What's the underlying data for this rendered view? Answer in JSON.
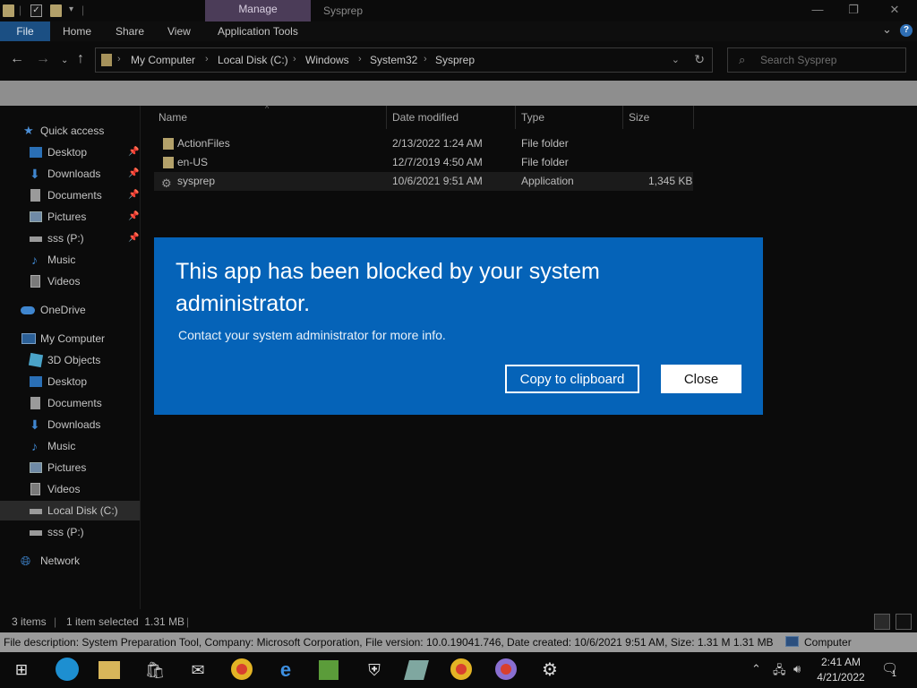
{
  "titlebar": {
    "manage_tab": "Manage",
    "title": "Sysprep",
    "min": "—",
    "restore": "❐",
    "close": "✕"
  },
  "ribbon": {
    "tabs": [
      "File",
      "Home",
      "Share",
      "View",
      "Application Tools"
    ],
    "expand": "⌄",
    "help": "?"
  },
  "address": {
    "crumbs": [
      "My Computer",
      "Local Disk (C:)",
      "Windows",
      "System32",
      "Sysprep"
    ],
    "search_placeholder": "Search Sysprep"
  },
  "sidebar": {
    "quick_access": "Quick access",
    "quick_items": [
      {
        "label": "Desktop",
        "icon": "desktop-icon",
        "pinned": true
      },
      {
        "label": "Downloads",
        "icon": "download-icon",
        "pinned": true
      },
      {
        "label": "Documents",
        "icon": "document-icon",
        "pinned": true
      },
      {
        "label": "Pictures",
        "icon": "pictures-icon",
        "pinned": true
      },
      {
        "label": "sss (P:)",
        "icon": "drive-icon",
        "pinned": true
      },
      {
        "label": "Music",
        "icon": "music-icon",
        "pinned": false
      },
      {
        "label": "Videos",
        "icon": "video-icon",
        "pinned": false
      }
    ],
    "onedrive": "OneDrive",
    "my_computer": "My Computer",
    "computer_items": [
      {
        "label": "3D Objects",
        "icon": "3d-objects-icon"
      },
      {
        "label": "Desktop",
        "icon": "desktop-icon"
      },
      {
        "label": "Documents",
        "icon": "document-icon"
      },
      {
        "label": "Downloads",
        "icon": "download-icon"
      },
      {
        "label": "Music",
        "icon": "music-icon"
      },
      {
        "label": "Pictures",
        "icon": "pictures-icon"
      },
      {
        "label": "Videos",
        "icon": "video-icon"
      },
      {
        "label": "Local Disk (C:)",
        "icon": "drive-icon",
        "selected": true
      },
      {
        "label": "sss (P:)",
        "icon": "drive-icon"
      }
    ],
    "network": "Network"
  },
  "filelist": {
    "columns": [
      "Name",
      "Date modified",
      "Type",
      "Size"
    ],
    "rows": [
      {
        "name": "ActionFiles",
        "date": "2/13/2022 1:24 AM",
        "type": "File folder",
        "size": "",
        "kind": "folder"
      },
      {
        "name": "en-US",
        "date": "12/7/2019 4:50 AM",
        "type": "File folder",
        "size": "",
        "kind": "folder"
      },
      {
        "name": "sysprep",
        "date": "10/6/2021 9:51 AM",
        "type": "Application",
        "size": "1,345 KB",
        "kind": "app"
      }
    ]
  },
  "dialog": {
    "title": "This app has been blocked by your system administrator.",
    "message": "Contact your system administrator for more info.",
    "copy_button": "Copy to clipboard",
    "close_button": "Close",
    "color": "#0563b8"
  },
  "status": {
    "items": "3 items",
    "selected": "1 item selected  1.31 MB"
  },
  "description_bar": {
    "text": "File description: System Preparation Tool, Company: Microsoft Corporation, File version: 10.0.19041.746, Date created: 10/6/2021 9:51 AM, Size: 1.31 M 1.31 MB",
    "computer": "Computer"
  },
  "taskbar": {
    "time": "2:41 AM",
    "date": "4/21/2022",
    "notification_count": "1"
  }
}
